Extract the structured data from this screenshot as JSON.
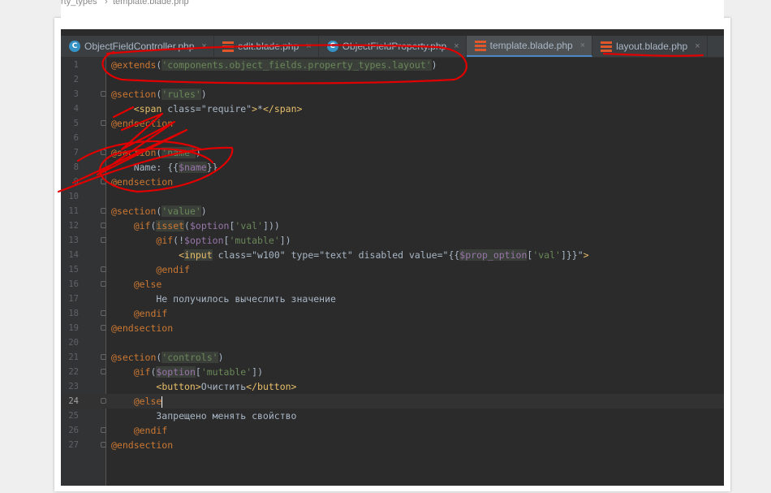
{
  "breadcrumb": {
    "left": "rty_types",
    "sep": "›",
    "file": "template.blade.php"
  },
  "tabs": [
    {
      "label": "ObjectFieldController.php",
      "icon": "class-c-icon",
      "active": false
    },
    {
      "label": "edit.blade.php",
      "icon": "blade-file-icon",
      "active": false
    },
    {
      "label": "ObjectFieldProperty.php",
      "icon": "class-c-icon",
      "active": false
    },
    {
      "label": "template.blade.php",
      "icon": "blade-file-icon",
      "active": true
    },
    {
      "label": "layout.blade.php",
      "icon": "blade-file-icon",
      "active": false
    }
  ],
  "tab_close": "×",
  "lines": [
    {
      "n": "1",
      "html": "<span class=\"kw\">@extends</span>(<span class=\"str hl\">'components.object_fields.property_types.layout'</span>)"
    },
    {
      "n": "2",
      "html": ""
    },
    {
      "n": "3",
      "html": "<span class=\"kw\">@section</span>(<span class=\"str hl\">'rules'</span>)"
    },
    {
      "n": "4",
      "html": "    <span class=\"tag\">&lt;span</span> class=\"require\"<span class=\"tag\">&gt;</span>*<span class=\"tag\">&lt;/span&gt;</span>"
    },
    {
      "n": "5",
      "html": "<span class=\"kw\">@endsection</span>"
    },
    {
      "n": "6",
      "html": ""
    },
    {
      "n": "7",
      "html": "<span class=\"kw\">@section</span>(<span class=\"str hl\">'name'</span>)"
    },
    {
      "n": "8",
      "html": "    Name: {{<span class=\"var hl\">$name</span>}}"
    },
    {
      "n": "9",
      "html": "<span class=\"kw\">@endsection</span>"
    },
    {
      "n": "10",
      "html": ""
    },
    {
      "n": "11",
      "html": "<span class=\"kw\">@section</span>(<span class=\"str hl\">'value'</span>)"
    },
    {
      "n": "12",
      "html": "    <span class=\"kw\">@if</span>(<span class=\"kw hl\">isset</span>(<span class=\"var\">$option</span>[<span class=\"str\">'val'</span>]))"
    },
    {
      "n": "13",
      "html": "        <span class=\"kw\">@if</span>(!<span class=\"var\">$option</span>[<span class=\"str\">'mutable'</span>])"
    },
    {
      "n": "14",
      "html": "            <span class=\"tag\">&lt;<span class=\"hl\">input</span></span> class=\"w100\" type=\"text\" disabled value=\"{{<span class=\"var hl\">$prop_option</span>[<span class=\"str\">'val'</span>]}}\"<span class=\"tag\">&gt;</span>"
    },
    {
      "n": "15",
      "html": "        <span class=\"kw\">@endif</span>"
    },
    {
      "n": "16",
      "html": "    <span class=\"kw\">@else</span>"
    },
    {
      "n": "17",
      "html": "        Не получилось вычеслить значение"
    },
    {
      "n": "18",
      "html": "    <span class=\"kw\">@endif</span>"
    },
    {
      "n": "19",
      "html": "<span class=\"kw\">@endsection</span>"
    },
    {
      "n": "20",
      "html": ""
    },
    {
      "n": "21",
      "html": "<span class=\"kw\">@section</span>(<span class=\"str hl\">'controls'</span>)"
    },
    {
      "n": "22",
      "html": "    <span class=\"kw\">@if</span>(<span class=\"var hl\">$option</span>[<span class=\"str\">'mutable'</span>])"
    },
    {
      "n": "23",
      "html": "        <span class=\"tag\">&lt;button&gt;</span>Очистить<span class=\"tag\">&lt;/button&gt;</span>"
    },
    {
      "n": "24",
      "html": "    <span class=\"kw\">@else</span><span class=\"caret\"></span>",
      "current": true
    },
    {
      "n": "25",
      "html": "        Запрещено менять свойство"
    },
    {
      "n": "26",
      "html": "    <span class=\"kw\">@endif</span>"
    },
    {
      "n": "27",
      "html": "<span class=\"kw\">@endsection</span>"
    }
  ],
  "colors": {
    "annotation": "#e00000",
    "keyword": "#cc7832",
    "string": "#6a8759",
    "variable": "#9876aa",
    "tag": "#e8bf6a"
  }
}
